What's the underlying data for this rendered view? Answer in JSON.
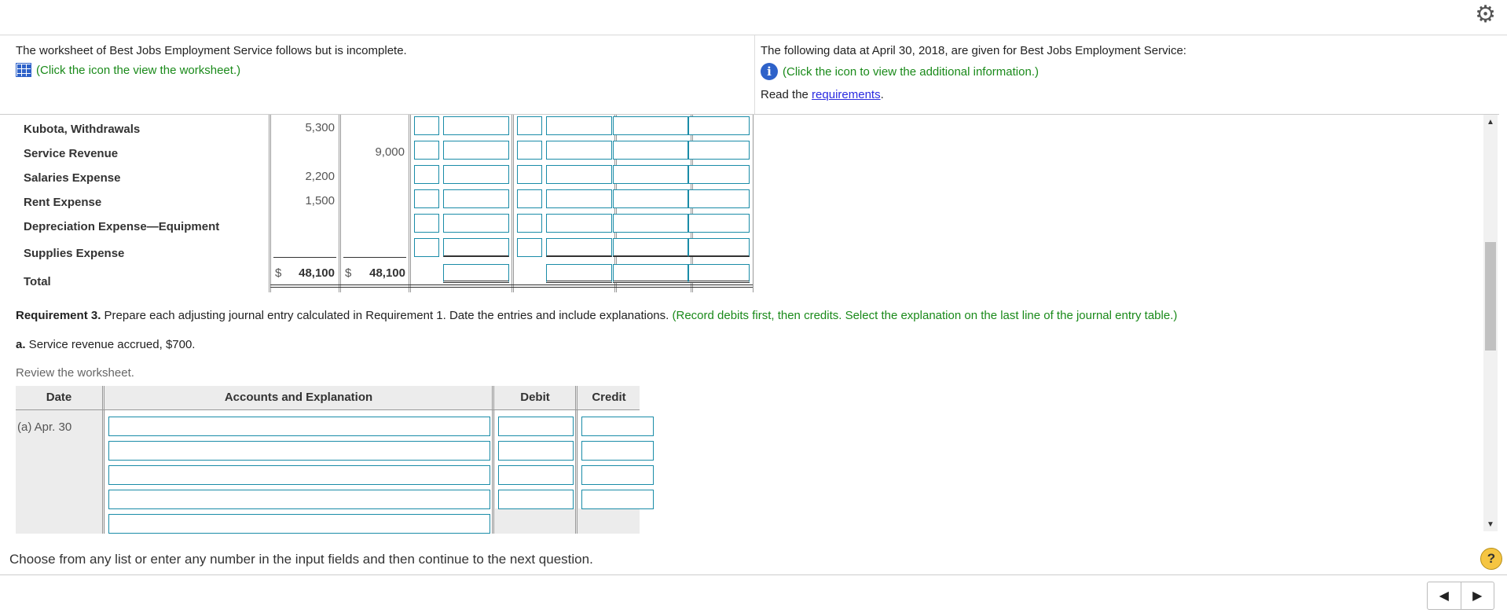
{
  "header": {
    "left_text": "The worksheet of Best Jobs Employment Service follows but is incomplete.",
    "left_link": "(Click the icon the view the worksheet.)",
    "right_text": "The following data at April 30, 2018, are given for Best Jobs Employment Service:",
    "right_link": "(Click the icon to view the additional information.)",
    "read_prefix": "Read the ",
    "read_link": "requirements",
    "read_suffix": "."
  },
  "worksheet": {
    "rows": [
      {
        "label": "Kubota, Withdrawals",
        "debit": "5,300",
        "credit": ""
      },
      {
        "label": "Service Revenue",
        "debit": "",
        "credit": "9,000"
      },
      {
        "label": "Salaries Expense",
        "debit": "2,200",
        "credit": ""
      },
      {
        "label": "Rent Expense",
        "debit": "1,500",
        "credit": ""
      },
      {
        "label": "Depreciation Expense—Equipment",
        "debit": "",
        "credit": ""
      },
      {
        "label": "Supplies Expense",
        "debit": "",
        "credit": ""
      }
    ],
    "total_label": "Total",
    "total_debit_symbol": "$",
    "total_debit": "48,100",
    "total_credit_symbol": "$",
    "total_credit": "48,100"
  },
  "requirement": {
    "label": "Requirement 3.",
    "text": " Prepare each adjusting journal entry calculated in Requirement 1. Date the entries and include explanations. ",
    "hint": "(Record debits first, then credits. Select the explanation on the last line of the journal entry table.)"
  },
  "part_a": {
    "label": "a.",
    "text": " Service revenue accrued, $700."
  },
  "review_text": "Review the worksheet.",
  "journal": {
    "headers": {
      "date": "Date",
      "accounts": "Accounts and Explanation",
      "debit": "Debit",
      "credit": "Credit"
    },
    "date_value": "(a) Apr. 30"
  },
  "footer": {
    "instruction": "Choose from any list or enter any number in the input fields and then continue to the next question.",
    "help": "?"
  },
  "colors": {
    "accent": "#1a8ca8",
    "hint_green": "#1a8a1a",
    "link_blue": "#2a2ae0",
    "icon_blue": "#2e62c9"
  }
}
